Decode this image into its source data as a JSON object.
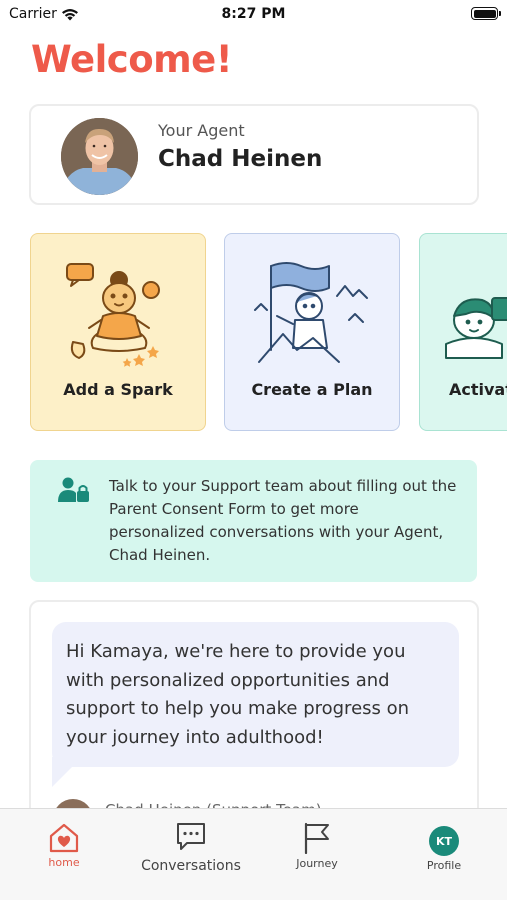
{
  "status_bar": {
    "carrier": "Carrier",
    "time": "8:27 PM",
    "battery_level": 1.0
  },
  "header": {
    "title": "Welcome!",
    "title_color": "#ee5a4a"
  },
  "agent": {
    "label": "Your Agent",
    "name": "Chad Heinen"
  },
  "actions": [
    {
      "label": "Add a Spark",
      "icon": "spark-illustration",
      "bg": "#fdf0c8"
    },
    {
      "label": "Create a Plan",
      "icon": "plan-flag-illustration",
      "bg": "#edf1fd"
    },
    {
      "label": "Activate",
      "icon": "activate-illustration",
      "bg": "#dbf7ef"
    }
  ],
  "consent": {
    "icon": "user-lock-icon",
    "text": "Talk to your Support team about filling out the Parent Consent Form to get more personalized conversations with your Agent, Chad Heinen."
  },
  "message": {
    "text": "Hi Kamaya, we're here to provide you with personalized opportunities and support to help you make progress on your journey into adulthood!",
    "sender": "Chad Heinen (Support Team)"
  },
  "tabbar": {
    "home": "home",
    "conversations": "Conversations",
    "journey": "Journey",
    "profile": "Profile",
    "profile_initials": "KT",
    "active": "home",
    "accent": "#e05a4a",
    "profile_color": "#1a8a7a"
  }
}
